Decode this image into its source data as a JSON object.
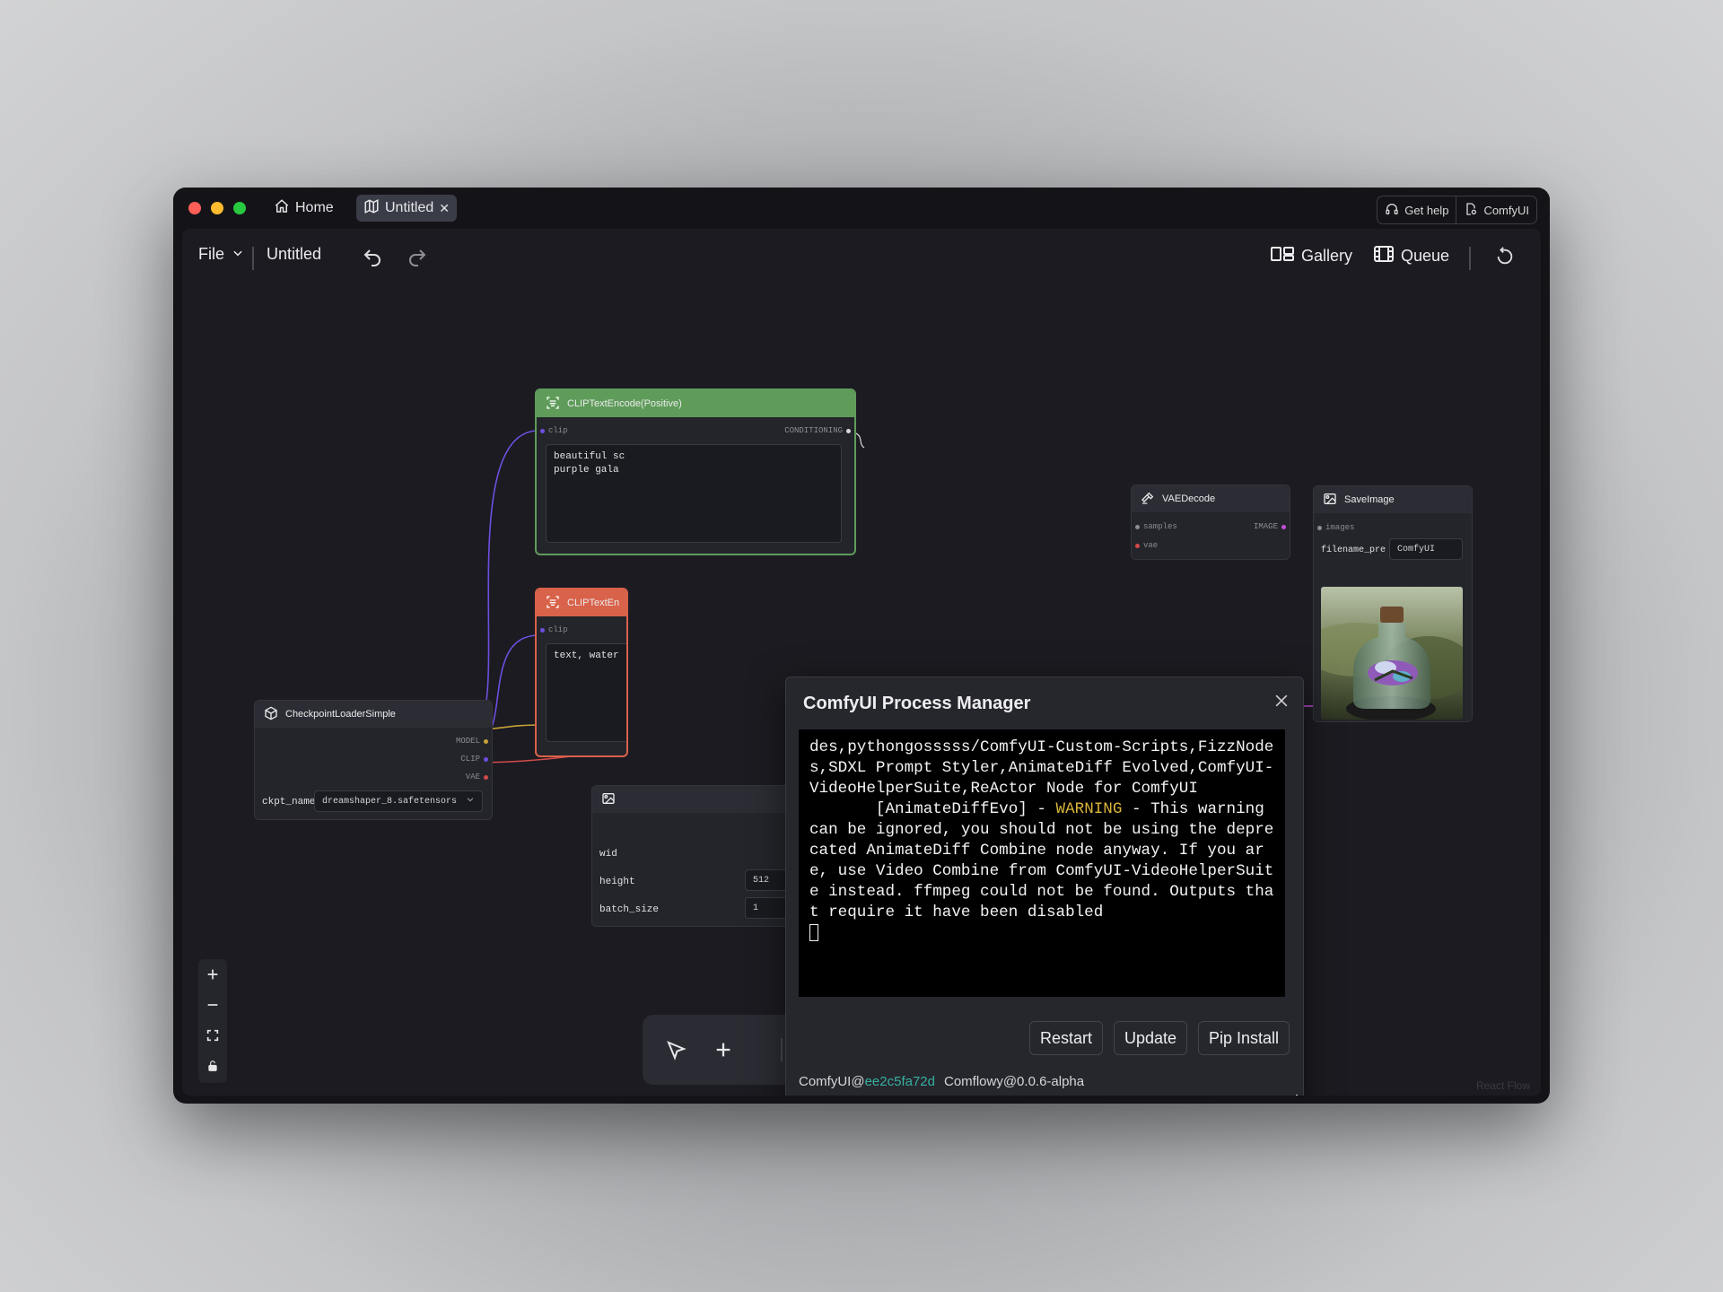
{
  "window": {
    "traffic_lights": {
      "close": "#ff5f57",
      "minimize": "#febc2e",
      "maximize": "#28c840"
    },
    "tabs": [
      {
        "label": "Home",
        "icon": "home-icon"
      },
      {
        "label": "Untitled",
        "icon": "map-icon",
        "active": true
      }
    ],
    "help_label": "Get help",
    "comfyui_label": "ComfyUI"
  },
  "toolbar": {
    "file_label": "File",
    "doc_title": "Untitled",
    "gallery_label": "Gallery",
    "queue_label": "Queue"
  },
  "nodes": {
    "positive": {
      "title": "CLIPTextEncode(Positive)",
      "input": "clip",
      "output": "CONDITIONING",
      "text": "beautiful sc\npurple gala",
      "color": "#5f9c5a"
    },
    "negative": {
      "title": "CLIPTextEn",
      "input": "clip",
      "text": "text, water",
      "color": "#d9624a"
    },
    "checkpoint": {
      "title": "CheckpointLoaderSimple",
      "outputs": [
        "MODEL",
        "CLIP",
        "VAE"
      ],
      "field_label": "ckpt_name",
      "field_value": "dreamshaper_8.safetensors"
    },
    "latent": {
      "fields": [
        {
          "label": "wid",
          "value": ""
        },
        {
          "label": "height",
          "value": "512"
        },
        {
          "label": "batch_size",
          "value": "1"
        }
      ]
    },
    "vae_decode": {
      "title": "VAEDecode",
      "inputs": [
        "samples",
        "vae"
      ],
      "output": "IMAGE"
    },
    "save_image": {
      "title": "SaveImage",
      "input": "images",
      "field_label": "filename_pre",
      "field_value": "ComfyUI"
    }
  },
  "dialog": {
    "title": "ComfyUI Process Manager",
    "terminal_lines": {
      "before_warning": "des,pythongosssss/ComfyUI-Custom-Scripts,FizzNodes,SDXL Prompt Styler,AnimateDiff Evolved,ComfyUI-VideoHelperSuite,ReActor Node for ComfyUI\n       [AnimateDiffEvo] - ",
      "warning": "WARNING",
      "after_warning": " - This warning can be ignored, you should not be using the deprecated AnimateDiff Combine node anyway. If you are, use Video Combine from ComfyUI-VideoHelperSuite instead. ffmpeg could not be found. Outputs that require it have been disabled\n"
    },
    "buttons": {
      "restart": "Restart",
      "update": "Update",
      "pip_install": "Pip Install"
    },
    "footer": {
      "comfy_prefix": "ComfyUI@",
      "comfy_hash": "ee2c5fa72d",
      "comflowy_version": "Comflowy@0.0.6-alpha"
    },
    "warning_color": "#d9b43a",
    "hash_color": "#36b0a0"
  },
  "attribution": "React Flow"
}
